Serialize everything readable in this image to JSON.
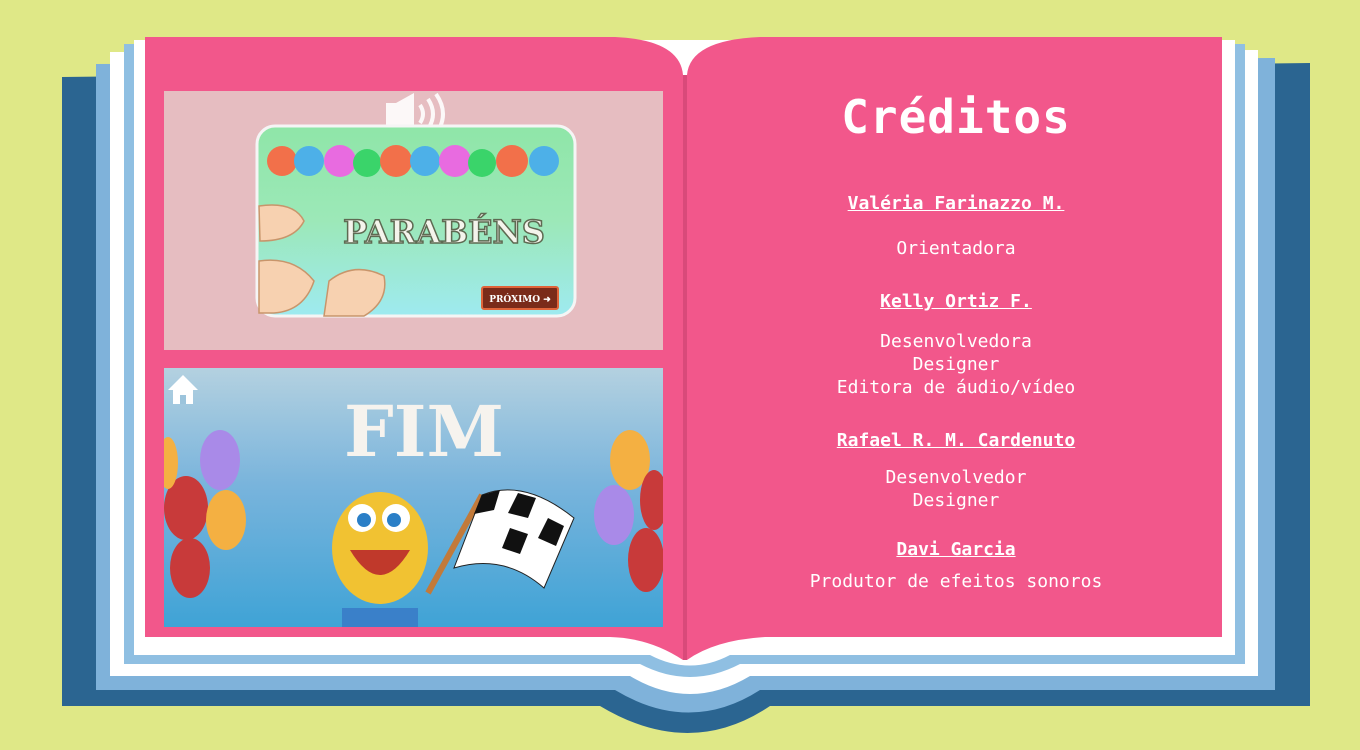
{
  "book": {
    "left_page": {
      "screens": [
        {
          "id": "congrats",
          "banner_text": "PARABÉNS",
          "next_button_label": "PRÓXIMO ➜"
        },
        {
          "id": "end",
          "title_text": "FIM"
        }
      ]
    },
    "right_page": {
      "title": "Créditos",
      "people": [
        {
          "name": "Valéria Farinazzo M.",
          "roles": [
            "Orientadora"
          ]
        },
        {
          "name": "Kelly Ortiz F.",
          "roles": [
            "Desenvolvedora",
            "Designer",
            "Editora de áudio/vídeo"
          ]
        },
        {
          "name": "Rafael R. M. Cardenuto",
          "roles": [
            "Desenvolvedor",
            "Designer"
          ]
        },
        {
          "name": "Davi Garcia",
          "roles": [
            "Produtor de efeitos sonoros"
          ]
        }
      ]
    }
  },
  "icons": {
    "sound": "speaker-icon",
    "home": "home-icon"
  },
  "colors": {
    "background": "#dfe887",
    "book_cover": "#2b6591",
    "book_light_blue": "#7fb2da",
    "page_pink": "#f2578b",
    "thumb_pink_bg": "#e6bdc1"
  }
}
